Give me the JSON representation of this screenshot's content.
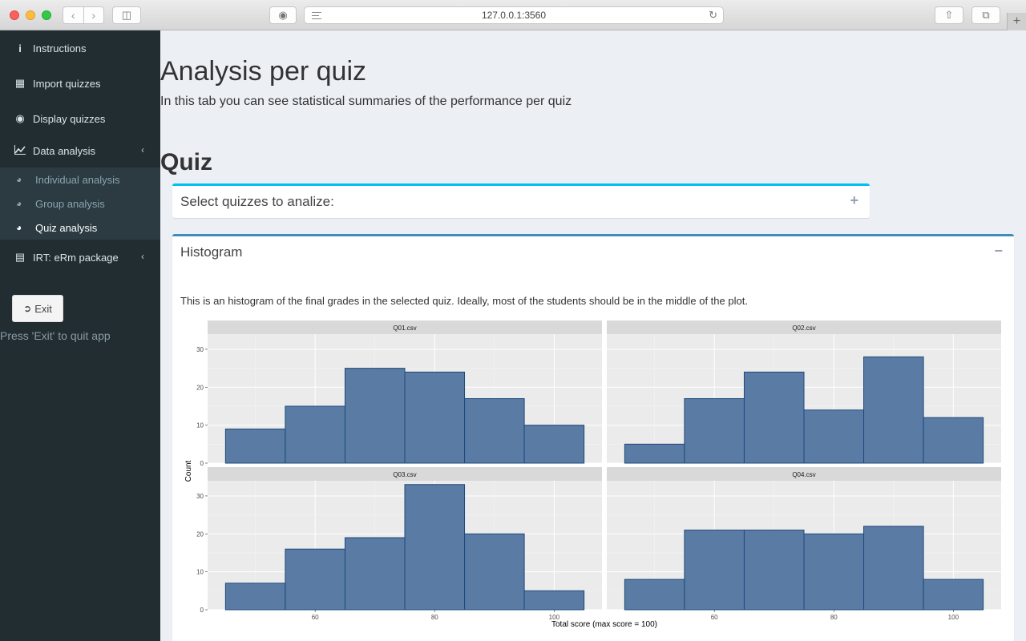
{
  "browser": {
    "url": "127.0.0.1:3560"
  },
  "sidebar": {
    "items": [
      {
        "label": "Instructions",
        "icon": "info-icon"
      },
      {
        "label": "Import quizzes",
        "icon": "grid-icon"
      },
      {
        "label": "Display quizzes",
        "icon": "eye-icon"
      },
      {
        "label": "Data analysis",
        "icon": "line-chart-icon"
      },
      {
        "label": "IRT: eRm package",
        "icon": "book-icon"
      }
    ],
    "subitems": [
      {
        "label": "Individual analysis",
        "icon": "dashboard-icon"
      },
      {
        "label": "Group analysis",
        "icon": "dashboard-icon"
      },
      {
        "label": "Quiz analysis",
        "icon": "dashboard-icon",
        "active": true
      }
    ],
    "exit_label": "Exit",
    "exit_hint": "Press 'Exit' to quit app"
  },
  "main": {
    "title": "Analysis per quiz",
    "subtitle": "In this tab you can see statistical summaries of the performance per quiz",
    "section_title": "Quiz",
    "select_box_title": "Select quizzes to analize:",
    "select_box_tool": "+",
    "hist_box_title": "Histogram",
    "hist_box_tool": "−",
    "hist_description": "This is an histogram of the final grades in the selected quiz. Ideally, most of the students should be in the middle of the plot."
  },
  "colors": {
    "bar_fill": "#5a7ba3",
    "bar_stroke": "#1e4a7c",
    "sidebar_bg": "#222d32",
    "accent_info": "#00c0ef",
    "accent_primary": "#3c8dbc"
  },
  "chart_data": {
    "type": "bar",
    "subtype": "histogram-facets",
    "xlabel": "Total score (max score = 100)",
    "ylabel": "Count",
    "x_ticks": [
      60,
      80,
      100
    ],
    "y_ticks": [
      0,
      10,
      20,
      30
    ],
    "xlim": [
      42,
      108
    ],
    "ylim": [
      0,
      34
    ],
    "bin_edges": [
      45,
      55,
      65,
      75,
      85,
      95,
      105
    ],
    "grid": true,
    "facets": [
      {
        "name": "Q01.csv",
        "counts": [
          9,
          15,
          25,
          24,
          17,
          10
        ]
      },
      {
        "name": "Q02.csv",
        "counts": [
          5,
          17,
          24,
          14,
          28,
          12
        ]
      },
      {
        "name": "Q03.csv",
        "counts": [
          7,
          16,
          19,
          33,
          20,
          5
        ]
      },
      {
        "name": "Q04.csv",
        "counts": [
          8,
          21,
          21,
          20,
          22,
          8
        ]
      }
    ]
  }
}
